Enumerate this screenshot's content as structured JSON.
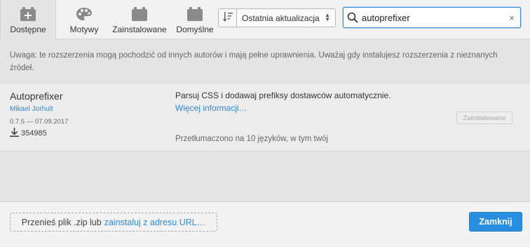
{
  "tabs": [
    {
      "label": "Dostępne",
      "icon": "puzzle-plus-icon",
      "active": true
    },
    {
      "label": "Motywy",
      "icon": "palette-icon",
      "active": false
    },
    {
      "label": "Zainstalowane",
      "icon": "box-icon",
      "active": false
    },
    {
      "label": "Domyślne",
      "icon": "box-icon",
      "active": false
    }
  ],
  "sort": {
    "icon": "sort-icon",
    "selected": "Ostatnia aktualizacja"
  },
  "search": {
    "value": "autoprefixer",
    "clear_label": "×"
  },
  "warning": "Uwaga: te rozszerzenia mogą pochodzić od innych autorów i mają pełne uprawnienia. Uważaj gdy instalujesz rozszerzenia z nieznanych źródeł.",
  "extension": {
    "title": "Autoprefixer",
    "author": "Mikael Jorhult",
    "version_date": "0.7.5 — 07.09.2017",
    "downloads": "354985",
    "description": "Parsuj CSS i dodawaj prefiksy dostawców automatycznie.",
    "more_info": "Więcej informacji…",
    "translated": "Przetłumaczono na 10 języków, w tym twój",
    "status": "Zainstalowane"
  },
  "footer": {
    "drop_text": "Przenieś plik .zip lub",
    "install_link": "zainstaluj z adresu URL…",
    "close_label": "Zamknij"
  },
  "colors": {
    "accent": "#288edf",
    "link": "#2e8ad8"
  }
}
